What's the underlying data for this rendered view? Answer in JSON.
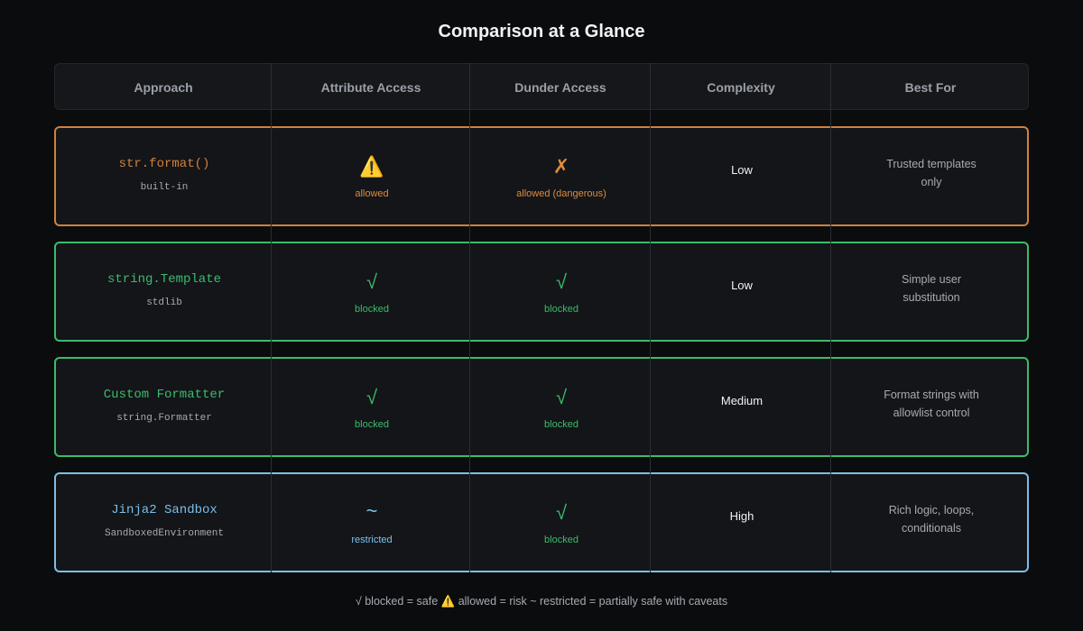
{
  "title": "Comparison at a Glance",
  "headers": [
    "Approach",
    "Attribute Access",
    "Dunder Access",
    "Complexity",
    "Best For"
  ],
  "colors": {
    "orange": "#e08a3c",
    "green": "#3dbb6b",
    "blue": "#7cc4ef",
    "yellow": "#f2c94c"
  },
  "rows": [
    {
      "name": "str.format()",
      "sub": "built-in",
      "accent": "#d0823a",
      "attr": {
        "icon": "warning-icon",
        "glyph": "⚠️",
        "label": "allowed",
        "color": "#e08a3c"
      },
      "dunder": {
        "icon": "cross-icon",
        "glyph": "✗",
        "label": "allowed (dangerous)",
        "color": "#e08a3c"
      },
      "complexity": "Low",
      "best_for": [
        "Trusted templates",
        "only"
      ]
    },
    {
      "name": "string.Template",
      "sub": "stdlib",
      "accent": "#3dbb6b",
      "attr": {
        "icon": "check-icon",
        "glyph": "√",
        "label": "blocked",
        "color": "#3dbb6b"
      },
      "dunder": {
        "icon": "check-icon",
        "glyph": "√",
        "label": "blocked",
        "color": "#3dbb6b"
      },
      "complexity": "Low",
      "best_for": [
        "Simple user",
        "substitution"
      ]
    },
    {
      "name": "Custom Formatter",
      "sub": "string.Formatter",
      "accent": "#3dbb6b",
      "attr": {
        "icon": "check-icon",
        "glyph": "√",
        "label": "blocked",
        "color": "#3dbb6b"
      },
      "dunder": {
        "icon": "check-icon",
        "glyph": "√",
        "label": "blocked",
        "color": "#3dbb6b"
      },
      "complexity": "Medium",
      "best_for": [
        "Format strings with",
        "allowlist control"
      ]
    },
    {
      "name": "Jinja2 Sandbox",
      "sub": "SandboxedEnvironment",
      "accent": "#7cbfe8",
      "attr": {
        "icon": "tilde-icon",
        "glyph": "~",
        "label": "restricted",
        "color": "#7cc4ef"
      },
      "dunder": {
        "icon": "check-icon",
        "glyph": "√",
        "label": "blocked",
        "color": "#3dbb6b"
      },
      "complexity": "High",
      "best_for": [
        "Rich logic, loops,",
        "conditionals"
      ]
    }
  ],
  "legend": "√ blocked = safe ⚠️ allowed = risk ~ restricted = partially safe with caveats"
}
